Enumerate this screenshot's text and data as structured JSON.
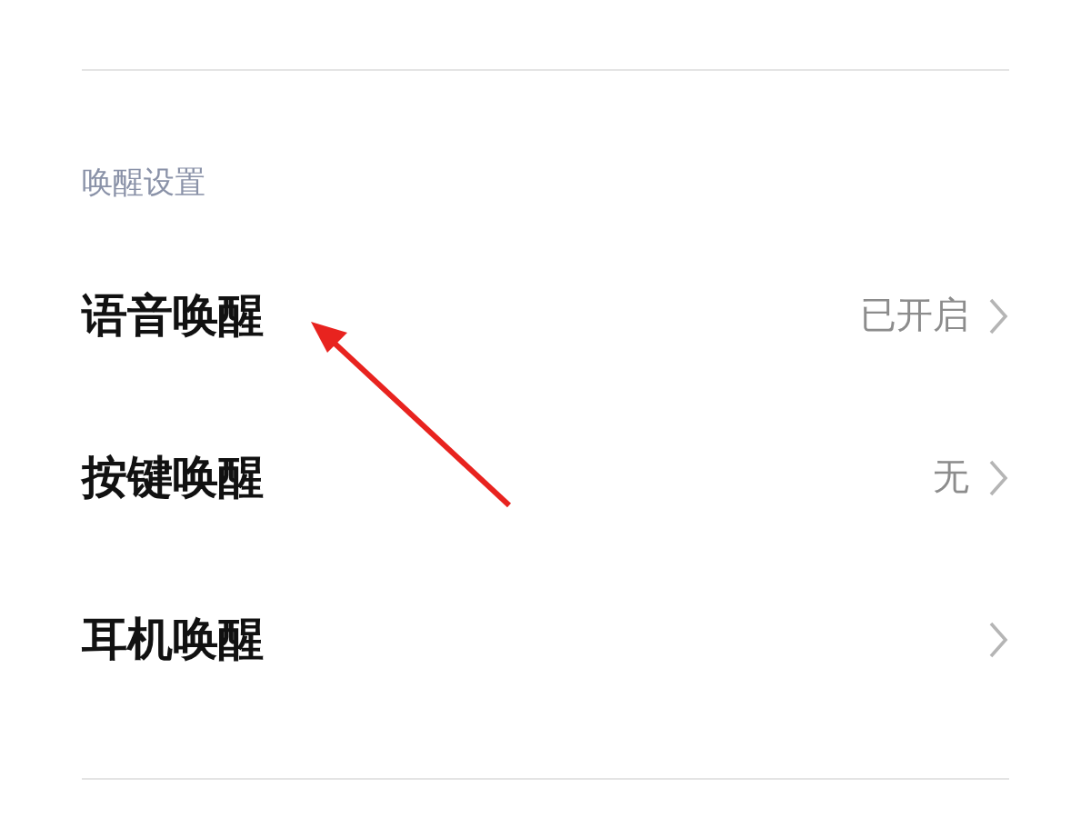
{
  "section": {
    "title": "唤醒设置",
    "rows": [
      {
        "label": "语音唤醒",
        "value": "已开启"
      },
      {
        "label": "按键唤醒",
        "value": "无"
      },
      {
        "label": "耳机唤醒"
      }
    ]
  },
  "annotation": {
    "kind": "arrow",
    "color": "#e8231f"
  }
}
